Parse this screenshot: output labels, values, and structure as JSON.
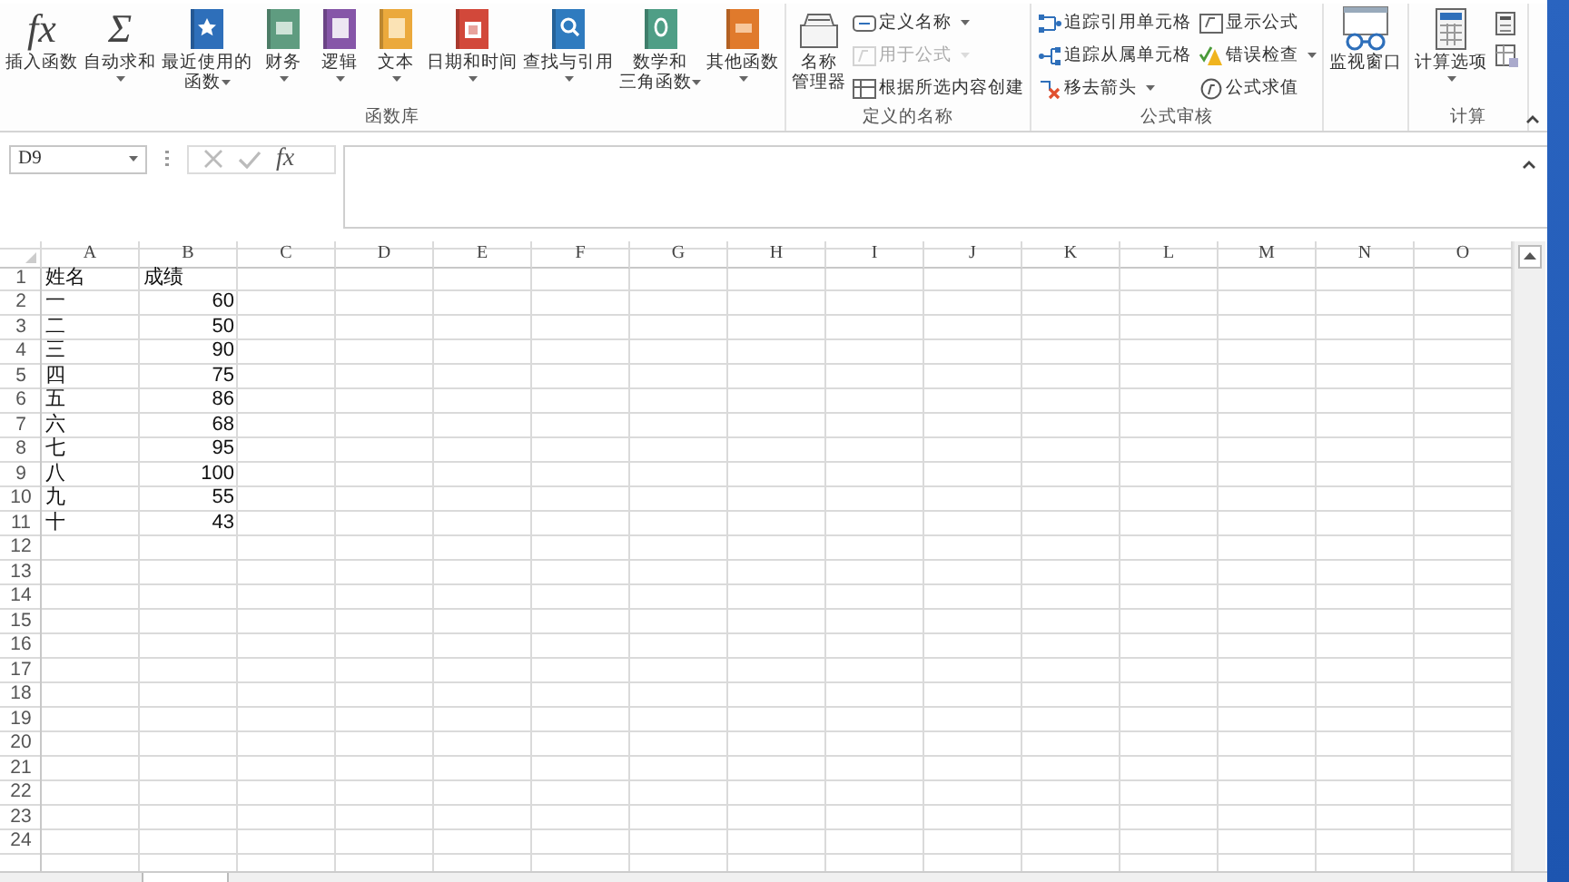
{
  "ribbon": {
    "groups": [
      {
        "label": "函数库",
        "buttons": [
          {
            "kind": "large",
            "label": "插入函数",
            "glyph": "fx",
            "dropdown": false,
            "disabled": false
          },
          {
            "kind": "large",
            "label": "自动求和",
            "glyph": "Σ",
            "dropdown": true,
            "disabled": false
          },
          {
            "kind": "large",
            "lines": [
              "最近使用的",
              "函数"
            ],
            "dropdown": true,
            "disabled": false
          },
          {
            "kind": "large",
            "label": "财务",
            "dropdown": true,
            "disabled": false
          },
          {
            "kind": "large",
            "label": "逻辑",
            "dropdown": true,
            "disabled": false
          },
          {
            "kind": "large",
            "label": "文本",
            "dropdown": true,
            "disabled": false
          },
          {
            "kind": "large",
            "label": "日期和时间",
            "dropdown": true,
            "disabled": false
          },
          {
            "kind": "large",
            "label": "查找与引用",
            "dropdown": true,
            "disabled": false
          },
          {
            "kind": "large",
            "lines": [
              "数学和",
              "三角函数"
            ],
            "dropdown": true,
            "disabled": false
          },
          {
            "kind": "large",
            "label": "其他函数",
            "dropdown": true,
            "disabled": false
          }
        ]
      },
      {
        "label": "定义的名称",
        "buttons": [
          {
            "kind": "large",
            "lines": [
              "名称",
              "管理器"
            ],
            "dropdown": false,
            "disabled": false
          },
          {
            "kind": "small",
            "label": "定义名称",
            "dropdown": true,
            "disabled": false
          },
          {
            "kind": "small",
            "label": "用于公式",
            "dropdown": true,
            "disabled": true
          },
          {
            "kind": "small",
            "label": "根据所选内容创建",
            "dropdown": false,
            "disabled": false
          }
        ]
      },
      {
        "label": "公式审核",
        "buttons": [
          {
            "kind": "small",
            "label": "追踪引用单元格",
            "dropdown": false,
            "disabled": false
          },
          {
            "kind": "small",
            "label": "追踪从属单元格",
            "dropdown": false,
            "disabled": false
          },
          {
            "kind": "small",
            "label": "移去箭头",
            "dropdown": true,
            "disabled": false
          },
          {
            "kind": "small",
            "label": "显示公式",
            "dropdown": false,
            "disabled": false
          },
          {
            "kind": "small",
            "label": "错误检查",
            "dropdown": true,
            "disabled": false
          },
          {
            "kind": "small",
            "label": "公式求值",
            "dropdown": false,
            "disabled": false
          }
        ]
      },
      {
        "buttons": [
          {
            "kind": "large",
            "label": "监视窗口",
            "dropdown": false,
            "disabled": false
          }
        ]
      },
      {
        "label": "计算",
        "buttons": [
          {
            "kind": "large",
            "label": "计算选项",
            "dropdown": true,
            "disabled": false
          },
          {
            "kind": "icon",
            "dropdown": false,
            "disabled": false
          },
          {
            "kind": "icon",
            "dropdown": false,
            "disabled": false
          }
        ]
      }
    ]
  },
  "formula_bar": {
    "name_box": "D9",
    "function_button": "fx"
  },
  "sheet": {
    "columns": [
      "A",
      "B",
      "C",
      "D",
      "E",
      "F",
      "G",
      "H",
      "I",
      "J",
      "K",
      "L",
      "M",
      "N",
      "O"
    ],
    "rows": [
      {
        "header": "1",
        "cells": [
          {
            "kind": "text",
            "text": "姓名"
          },
          {
            "kind": "text",
            "text": "成绩"
          }
        ]
      },
      {
        "header": "2",
        "cells": [
          {
            "kind": "text",
            "text": "一"
          },
          {
            "kind": "number",
            "text": "60"
          }
        ]
      },
      {
        "header": "3",
        "cells": [
          {
            "kind": "text",
            "text": "二"
          },
          {
            "kind": "number",
            "text": "50"
          }
        ]
      },
      {
        "header": "4",
        "cells": [
          {
            "kind": "text",
            "text": "三"
          },
          {
            "kind": "number",
            "text": "90"
          }
        ]
      },
      {
        "header": "5",
        "cells": [
          {
            "kind": "text",
            "text": "四"
          },
          {
            "kind": "number",
            "text": "75"
          }
        ]
      },
      {
        "header": "6",
        "cells": [
          {
            "kind": "text",
            "text": "五"
          },
          {
            "kind": "number",
            "text": "86"
          }
        ]
      },
      {
        "header": "7",
        "cells": [
          {
            "kind": "text",
            "text": "六"
          },
          {
            "kind": "number",
            "text": "68"
          }
        ]
      },
      {
        "header": "8",
        "cells": [
          {
            "kind": "text",
            "text": "七"
          },
          {
            "kind": "number",
            "text": "95"
          }
        ]
      },
      {
        "header": "9",
        "cells": [
          {
            "kind": "text",
            "text": "八"
          },
          {
            "kind": "number",
            "text": "100"
          }
        ]
      },
      {
        "header": "10",
        "cells": [
          {
            "kind": "text",
            "text": "九"
          },
          {
            "kind": "number",
            "text": "55"
          }
        ]
      },
      {
        "header": "11",
        "cells": [
          {
            "kind": "text",
            "text": "十"
          },
          {
            "kind": "number",
            "text": "43"
          }
        ]
      },
      {
        "header": "12"
      },
      {
        "header": "13"
      },
      {
        "header": "14"
      },
      {
        "header": "15"
      },
      {
        "header": "16"
      },
      {
        "header": "17"
      },
      {
        "header": "18"
      },
      {
        "header": "19"
      },
      {
        "header": "20"
      },
      {
        "header": "21"
      },
      {
        "header": "22"
      },
      {
        "header": "23"
      },
      {
        "header": "24"
      }
    ]
  }
}
